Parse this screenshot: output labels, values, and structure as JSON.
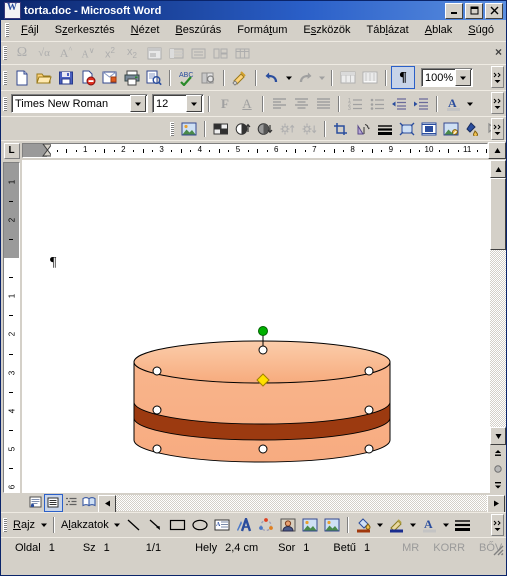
{
  "window": {
    "title": "torta.doc - Microsoft Word",
    "icon": "word-document-icon",
    "minimize": "_",
    "maximize": "□",
    "close": "×"
  },
  "menubar": {
    "items": [
      {
        "label": "Fájl",
        "accel": "F"
      },
      {
        "label": "Szerkesztés",
        "accel": "z"
      },
      {
        "label": "Nézet",
        "accel": "N"
      },
      {
        "label": "Beszúrás",
        "accel": "B"
      },
      {
        "label": "Formátum",
        "accel": "t"
      },
      {
        "label": "Eszközök",
        "accel": "z"
      },
      {
        "label": "Táblázat",
        "accel": "l"
      },
      {
        "label": "Ablak",
        "accel": "A"
      },
      {
        "label": "Súgó",
        "accel": "S"
      }
    ],
    "close_window_label": "×"
  },
  "symbol_toolbar": {
    "name": "symbol-toolbar",
    "disabled": true,
    "buttons": [
      {
        "name": "insert-symbol-icon",
        "glyph": "Ω"
      },
      {
        "name": "insert-equation-icon",
        "glyph": "√α"
      },
      {
        "name": "increase-font-size-icon",
        "glyph": "A"
      },
      {
        "name": "decrease-font-size-icon",
        "glyph": "A"
      },
      {
        "name": "superscript-icon",
        "glyph": "x²"
      },
      {
        "name": "subscript-icon",
        "glyph": "x₂"
      },
      {
        "name": "insert-frame-icon",
        "glyph": ""
      },
      {
        "name": "merge-cells-icon",
        "glyph": ""
      },
      {
        "name": "align-cell-icon",
        "glyph": ""
      },
      {
        "name": "split-cells-icon",
        "glyph": ""
      },
      {
        "name": "insert-table-icon",
        "glyph": ""
      }
    ]
  },
  "standard_toolbar": {
    "name": "standard-toolbar",
    "buttons": [
      {
        "name": "new-document-icon",
        "label": "Új"
      },
      {
        "name": "open-icon",
        "label": "Megnyitás"
      },
      {
        "name": "save-icon",
        "label": "Mentés"
      },
      {
        "name": "permission-icon",
        "label": "Engedély"
      },
      {
        "name": "email-icon",
        "label": "E-mail"
      },
      {
        "name": "print-icon",
        "label": "Nyomtatás"
      },
      {
        "name": "print-preview-icon",
        "label": "Nyomtatási kép"
      },
      {
        "name": "spelling-check-icon",
        "label": "Helyesírás"
      },
      {
        "name": "research-icon",
        "label": "Forrás"
      },
      {
        "name": "format-painter-icon",
        "label": "Formátummásoló"
      },
      {
        "name": "undo-icon",
        "label": "Visszavonás"
      },
      {
        "name": "redo-icon",
        "label": "Mégis"
      },
      {
        "name": "insert-table-icon",
        "label": "Táblázat beszúrása"
      },
      {
        "name": "columns-icon",
        "label": "Hasábok"
      },
      {
        "name": "show-formatting-marks-icon",
        "label": "Formázási jelek",
        "pressed": true
      }
    ],
    "zoom": {
      "value": "100%",
      "name": "zoom-combo"
    }
  },
  "formatting_toolbar": {
    "name": "formatting-toolbar",
    "font": {
      "value": "Times New Roman",
      "name": "font-name-combo"
    },
    "size": {
      "value": "12",
      "name": "font-size-combo"
    },
    "buttons": [
      {
        "name": "bold-icon",
        "glyph": "F"
      },
      {
        "name": "underline-icon",
        "glyph": "A"
      },
      {
        "name": "align-left-icon"
      },
      {
        "name": "align-center-icon"
      },
      {
        "name": "align-justify-icon"
      },
      {
        "name": "numbered-list-icon"
      },
      {
        "name": "bulleted-list-icon"
      },
      {
        "name": "decrease-indent-icon"
      },
      {
        "name": "increase-indent-icon"
      },
      {
        "name": "font-color-icon"
      }
    ]
  },
  "picture_toolbar": {
    "name": "picture-toolbar",
    "buttons": [
      {
        "name": "insert-picture-icon"
      },
      {
        "name": "color-mode-icon"
      },
      {
        "name": "more-contrast-icon"
      },
      {
        "name": "less-contrast-icon"
      },
      {
        "name": "more-brightness-icon"
      },
      {
        "name": "less-brightness-icon"
      },
      {
        "name": "crop-icon"
      },
      {
        "name": "rotate-left-icon"
      },
      {
        "name": "line-style-icon"
      },
      {
        "name": "compress-pictures-icon"
      },
      {
        "name": "text-wrapping-icon"
      },
      {
        "name": "format-picture-icon"
      },
      {
        "name": "set-transparent-color-icon"
      },
      {
        "name": "reset-picture-icon"
      }
    ]
  },
  "ruler": {
    "horizontal": {
      "name": "horizontal-ruler",
      "unit": "cm",
      "numbers": [
        1,
        2,
        3,
        4,
        5,
        6,
        7,
        8,
        9,
        10,
        11
      ],
      "left_margin_cm": 0,
      "tab_selector": "L"
    },
    "vertical": {
      "name": "vertical-ruler",
      "margin_numbers": [
        2,
        1
      ],
      "numbers": [
        1,
        2,
        3,
        4,
        5,
        6
      ]
    }
  },
  "document": {
    "name": "document-page",
    "paragraph_mark": "¶",
    "shape": {
      "name": "cake-autoshape",
      "alt": "torta",
      "fill_color": "#f8b183",
      "top_fill_color": "#fac6a3",
      "band_color": "#9c3a10",
      "band_color_light": "#a8430f",
      "outline_color": "#000000",
      "selected": true,
      "handles": {
        "rotate_color": "#00a000",
        "adjust_color": "#ffe000",
        "size_color": "#ffffff"
      }
    }
  },
  "view_buttons": [
    {
      "name": "normal-view-button",
      "label": "Normál"
    },
    {
      "name": "web-layout-view-button",
      "label": "Weblap"
    },
    {
      "name": "print-layout-view-button",
      "label": "Nyomtatási elrendezés",
      "selected": true
    },
    {
      "name": "outline-view-button",
      "label": "Vázlat"
    },
    {
      "name": "reading-layout-view-button",
      "label": "Olvasási elrendezés"
    }
  ],
  "scrollbars": {
    "vertical": {
      "name": "vertical-scrollbar",
      "up": "▲",
      "down": "▼",
      "previous_page": "⯅",
      "select_browse_object": "○",
      "next_page": "⯆"
    },
    "horizontal": {
      "name": "horizontal-scrollbar",
      "left": "◀",
      "right": "▶"
    }
  },
  "drawing_toolbar": {
    "name": "drawing-toolbar",
    "draw_menu": {
      "label": "Rajz",
      "accel": "R"
    },
    "autoshapes_menu": {
      "label": "Alakzatok",
      "accel": "l"
    },
    "buttons": [
      {
        "name": "line-icon"
      },
      {
        "name": "arrow-icon"
      },
      {
        "name": "rectangle-icon"
      },
      {
        "name": "oval-icon"
      },
      {
        "name": "text-box-icon"
      },
      {
        "name": "wordart-icon"
      },
      {
        "name": "diagram-icon"
      },
      {
        "name": "clip-art-icon"
      },
      {
        "name": "insert-picture-icon"
      },
      {
        "name": "insert-picture-from-file-icon"
      },
      {
        "name": "fill-color-icon"
      },
      {
        "name": "line-color-icon"
      },
      {
        "name": "font-color-icon"
      },
      {
        "name": "line-style-icon"
      }
    ]
  },
  "statusbar": {
    "name": "status-bar",
    "page_label": "Oldal",
    "page_value": "1",
    "section_label": "Sz",
    "section_value": "1",
    "pages": "1/1",
    "position_label": "Hely",
    "position_value": "2,4 cm",
    "line_label": "Sor",
    "line_value": "1",
    "column_label": "Betű",
    "column_value": "1",
    "indicators": [
      {
        "name": "record-macro-indicator",
        "label": "MR",
        "enabled": false
      },
      {
        "name": "track-changes-indicator",
        "label": "KORR",
        "enabled": false
      },
      {
        "name": "extend-selection-indicator",
        "label": "BŐV",
        "enabled": false
      }
    ]
  },
  "colors": {
    "titlebar_start": "#0a246a",
    "face": "#d4d0c8",
    "page": "#ffffff",
    "shadow": "#808080"
  }
}
